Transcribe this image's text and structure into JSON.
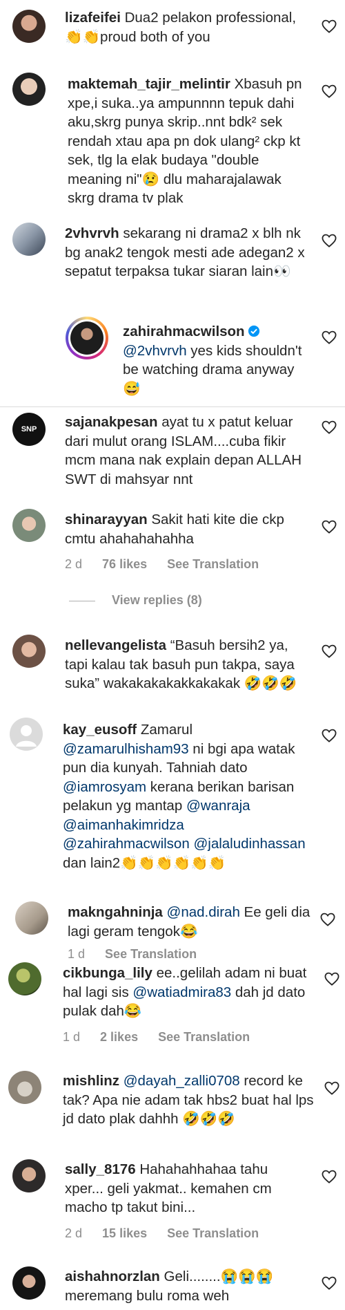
{
  "comments": [
    {
      "username": "lizafeifei",
      "text": "Dua2 pelakon professional, 👏👏proud both of you"
    },
    {
      "username": "maktemah_tajir_melintir",
      "text": "Xbasuh pn xpe,i suka..ya ampunnnn tepuk dahi aku,skrg punya skrip..nnt bdk² sek rendah xtau apa pn dok ulang² ckp kt sek, tlg la elak budaya \"double meaning ni\"😢 dlu maharajalawak skrg drama tv plak"
    },
    {
      "username": "2vhvrvh",
      "text": "sekarang ni drama2 x blh nk bg anak2 tengok mesti ade adegan2 x sepatut terpaksa tukar siaran lain👀"
    },
    {
      "username": "zahirahmacwilson",
      "mention": "@2vhvrvh",
      "text": " yes kids shouldn't be watching drama anyway 😅"
    },
    {
      "username": "sajanakpesan",
      "text": "ayat tu x patut keluar dari mulut orang ISLAM....cuba fikir mcm mana nak explain depan ALLAH SWT di mahsyar nnt",
      "avatar_text": "SNP"
    },
    {
      "username": "shinarayyan",
      "text": "Sakit hati kite die ckp cmtu ahahahahahha",
      "time": "2 d",
      "likes": "76 likes",
      "translation": "See Translation"
    },
    {
      "username": "nellevangelista",
      "text": "“Basuh bersih2 ya, tapi kalau tak basuh pun takpa, saya suka” wakakakakakkakakak 🤣🤣🤣"
    },
    {
      "username": "kay_eusoff",
      "pre": "Zamarul ",
      "m1": "@zamarulhisham93",
      "mid1": " ni bgi apa watak pun dia kunyah. Tahniah dato ",
      "m2": "@iamrosyam",
      "mid2": " kerana berikan barisan pelakun yg mantap ",
      "m3": "@wanraja",
      "m4": "@aimanhakimridza",
      "m5": "@zahirahmacwilson",
      "m6": "@jalaludinhassan",
      "tail": " dan lain2👏👏👏👏👏👏"
    },
    {
      "username": "makngahninja",
      "mention": "@nad.dirah",
      "text": " Ee geli dia lagi geram tengok😂",
      "time": "1 d",
      "translation": "See Translation"
    },
    {
      "username": "cikbunga_lily",
      "pre": "ee..gelilah adam ni buat hal lagi sis ",
      "mention": "@watiadmira83",
      "text": " dah jd dato pulak dah😂",
      "time": "1 d",
      "likes": "2 likes",
      "translation": "See Translation"
    },
    {
      "username": "mishlinz",
      "mention": "@dayah_zalli0708",
      "text": " record ke tak? Apa nie adam tak hbs2 buat hal lps jd dato plak dahhh 🤣🤣🤣"
    },
    {
      "username": "sally_8176",
      "text": "Hahahahhahaa tahu xper... geli yakmat.. kemahen cm macho tp takut bini...",
      "time": "2 d",
      "likes": "15 likes",
      "translation": "See Translation"
    },
    {
      "username": "aishahnorzlan",
      "text": "Geli........😭😭😭 meremang bulu roma weh"
    }
  ],
  "view_replies": "View replies (8)",
  "colors": {
    "text": "#262626",
    "mention": "#00376b",
    "meta": "#8e8e8e",
    "verified": "#0095f6"
  }
}
